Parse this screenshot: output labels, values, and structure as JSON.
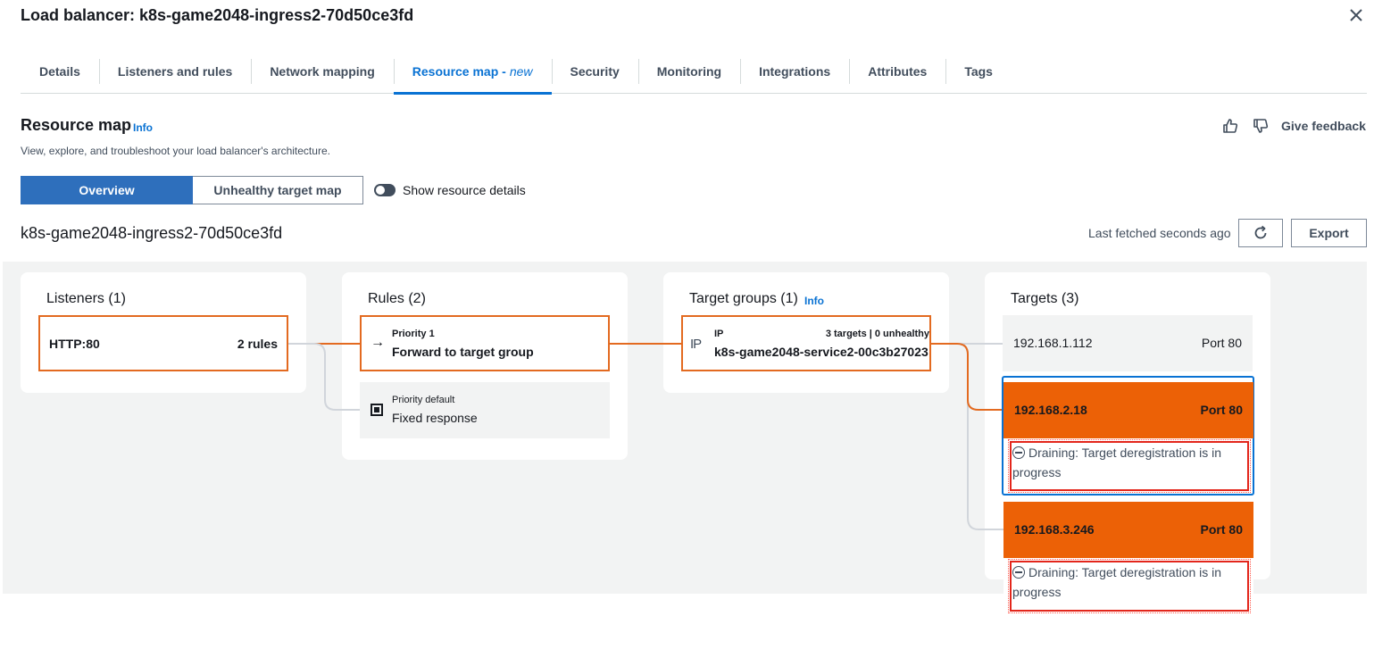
{
  "header": {
    "title": "Load balancer: k8s-game2048-ingress2-70d50ce3fd",
    "close_icon": "close-icon"
  },
  "tabs": [
    {
      "label": "Details"
    },
    {
      "label": "Listeners and rules"
    },
    {
      "label": "Network mapping"
    },
    {
      "label": "Resource map -",
      "suffix": "new",
      "active": true
    },
    {
      "label": "Security"
    },
    {
      "label": "Monitoring"
    },
    {
      "label": "Integrations"
    },
    {
      "label": "Attributes"
    },
    {
      "label": "Tags"
    }
  ],
  "section": {
    "title": "Resource map",
    "info": "Info",
    "description": "View, explore, and troubleshoot your load balancer's architecture.",
    "feedback": "Give feedback"
  },
  "view_toggle": {
    "overview": "Overview",
    "unhealthy": "Unhealthy target map",
    "show_details": "Show resource details"
  },
  "toolbar": {
    "lb_name": "k8s-game2048-ingress2-70d50ce3fd",
    "last_fetched": "Last fetched seconds ago",
    "export": "Export"
  },
  "map": {
    "listeners": {
      "title": "Listeners (1)",
      "items": [
        {
          "protocol": "HTTP:80",
          "rules": "2 rules"
        }
      ]
    },
    "rules": {
      "title": "Rules (2)",
      "items": [
        {
          "priority": "Priority 1",
          "action": "Forward to target group"
        },
        {
          "priority": "Priority default",
          "action": "Fixed response"
        }
      ]
    },
    "target_groups": {
      "title": "Target groups (1)",
      "info": "Info",
      "items": [
        {
          "type": "IP",
          "counts": "3 targets | 0 unhealthy",
          "name": "k8s-game2048-service2-00c3b27023"
        }
      ]
    },
    "targets": {
      "title": "Targets (3)",
      "items": [
        {
          "ip": "192.168.1.112",
          "port": "Port 80"
        },
        {
          "ip": "192.168.2.18",
          "port": "Port 80",
          "status": "Draining: Target deregistration is in progress"
        },
        {
          "ip": "192.168.3.246",
          "port": "Port 80",
          "status": "Draining: Target deregistration is in progress"
        }
      ]
    }
  },
  "colors": {
    "accent": "#0972d3",
    "node_border": "#e36a20",
    "draining_fill": "#ec6106",
    "annotation": "#e3261b"
  }
}
